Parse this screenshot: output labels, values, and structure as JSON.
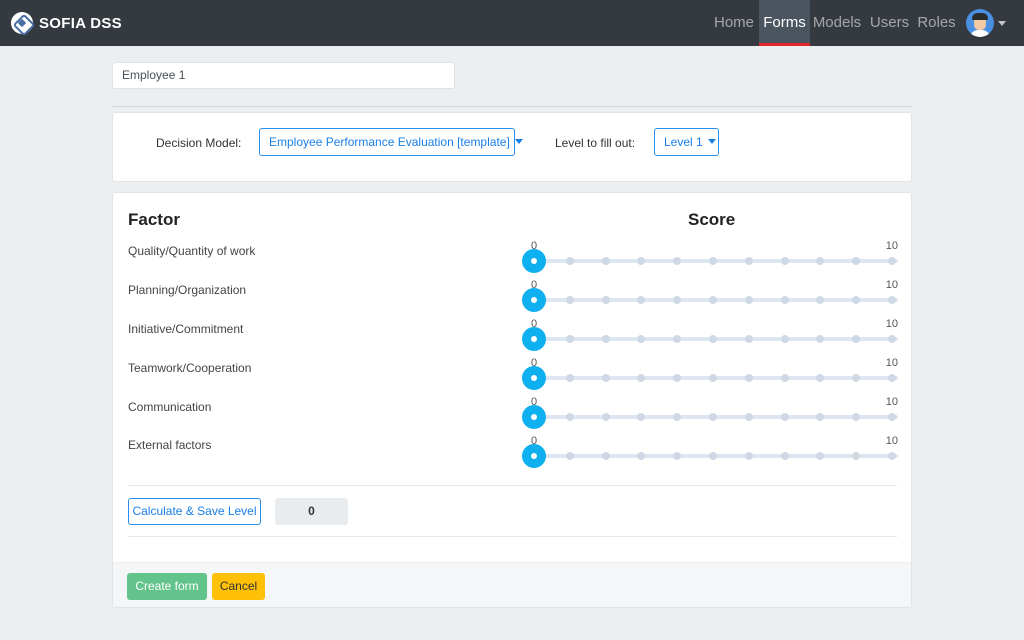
{
  "navbar": {
    "brand": "SOFIA DSS",
    "links": [
      {
        "label": "Home",
        "active": false
      },
      {
        "label": "Forms",
        "active": true
      },
      {
        "label": "Models",
        "active": false
      },
      {
        "label": "Users",
        "active": false
      },
      {
        "label": "Roles",
        "active": false
      }
    ],
    "active_indicator_color": "#e0242c"
  },
  "form": {
    "title_value": "Employee 1",
    "decision_model_label": "Decision Model:",
    "decision_model_value": "Employee Performance Evaluation [template]",
    "level_label": "Level to fill out:",
    "level_value": "Level 1",
    "factor_header": "Factor",
    "score_header": "Score",
    "factors": [
      {
        "label": "Quality/Quantity of work",
        "min": "0",
        "max": "10",
        "value": 0
      },
      {
        "label": "Planning/Organization",
        "min": "0",
        "max": "10",
        "value": 0
      },
      {
        "label": "Initiative/Commitment",
        "min": "0",
        "max": "10",
        "value": 0
      },
      {
        "label": "Teamwork/Cooperation",
        "min": "0",
        "max": "10",
        "value": 0
      },
      {
        "label": "Communication",
        "min": "0",
        "max": "10",
        "value": 0
      },
      {
        "label": "External factors",
        "min": "0",
        "max": "10",
        "value": 0
      }
    ],
    "calculate_label": "Calculate & Save Level",
    "result_value": "0",
    "create_label": "Create form",
    "cancel_label": "Cancel"
  },
  "colors": {
    "navbar_bg": "#343a40",
    "primary": "#1a7fe6",
    "slider_thumb": "#0fb0f0",
    "success": "#62c48a",
    "warning": "#ffc107"
  }
}
